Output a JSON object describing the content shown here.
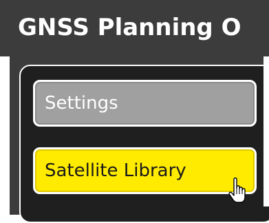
{
  "header": {
    "title": "GNSS Planning O"
  },
  "menu": {
    "items": [
      {
        "label": "Settings",
        "state": "default"
      },
      {
        "label": "Satellite Library",
        "state": "hover"
      }
    ]
  },
  "colors": {
    "header_bg": "#3c3c3c",
    "panel_bg": "#1f1f1f",
    "button_default": "#a0a0a0",
    "button_hover": "#ffeb00"
  },
  "cursor": {
    "icon": "hand-pointer-icon"
  }
}
